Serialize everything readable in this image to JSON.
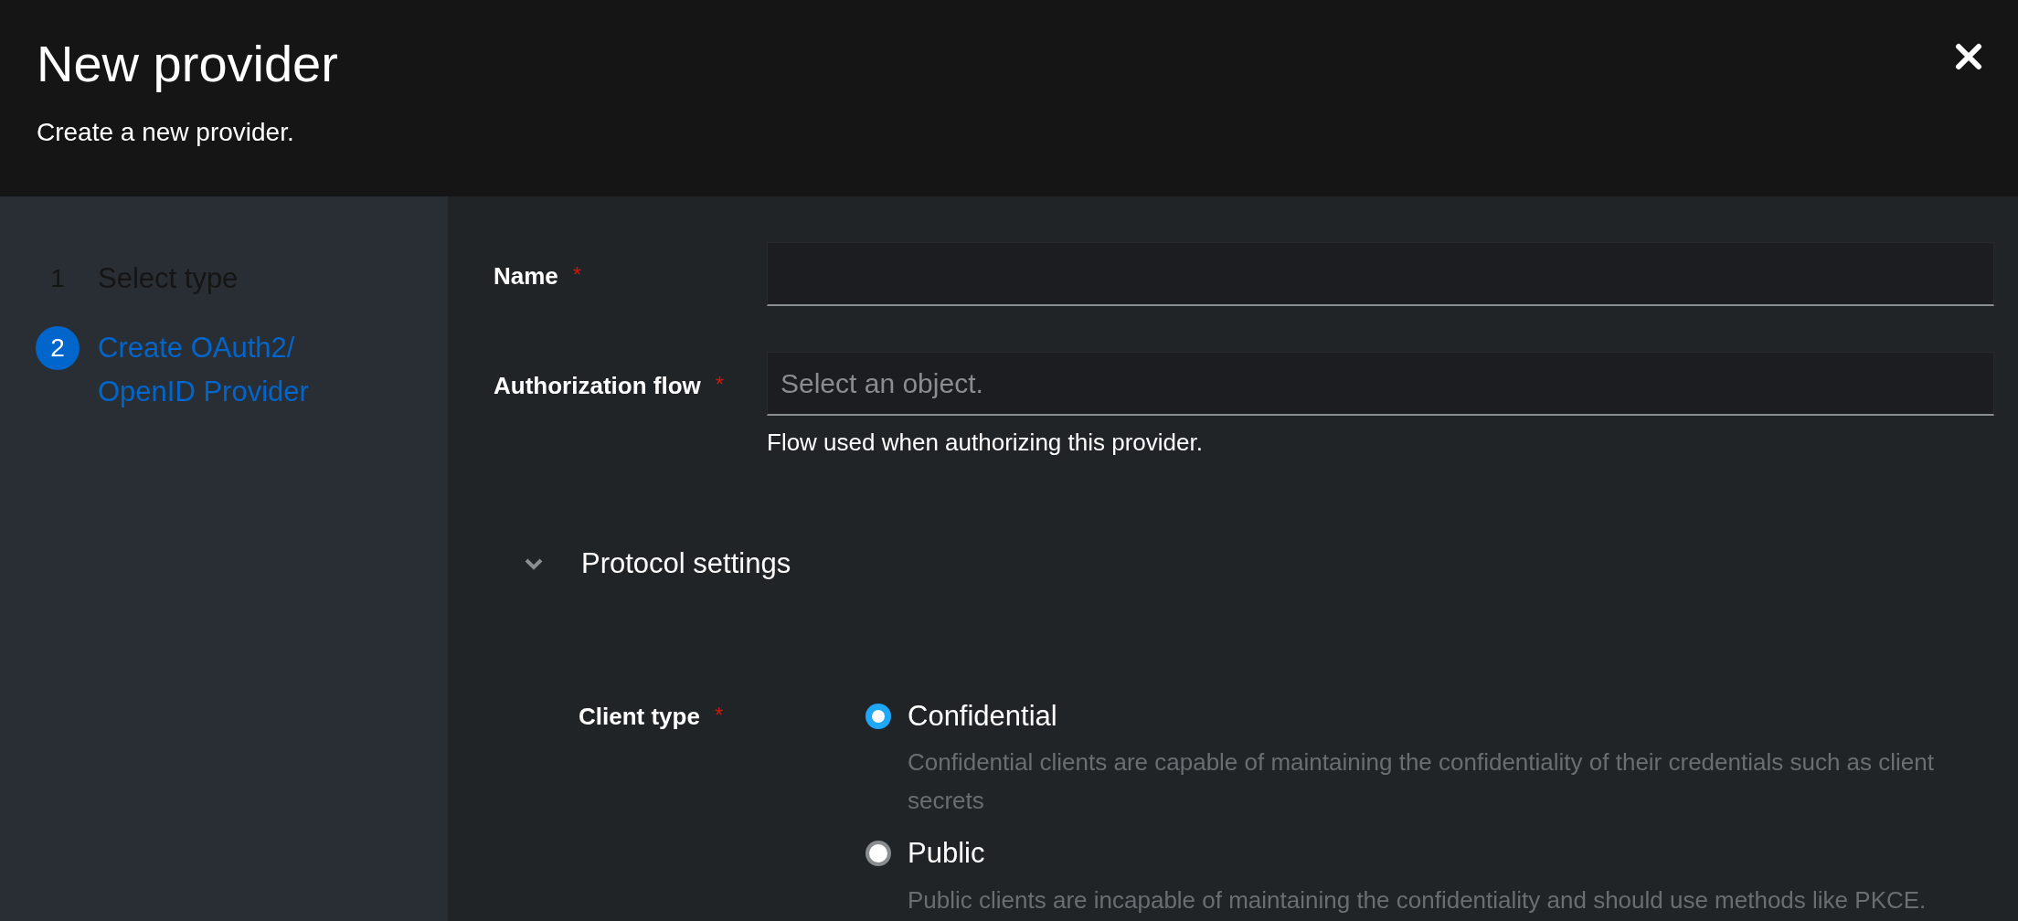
{
  "header": {
    "title": "New provider",
    "subtitle": "Create a new provider."
  },
  "steps": [
    {
      "number": "1",
      "label": "Select type",
      "selected": false
    },
    {
      "number": "2",
      "label": "Create OAuth2/ OpenID Provider",
      "selected": true
    }
  ],
  "fields": [
    {
      "label": "Name",
      "required_mark": "*"
    },
    {
      "label": "Authorization flow",
      "required_mark": "*",
      "placeholder": "Select an object.",
      "helper": "Flow used when authorizing this provider."
    }
  ],
  "section": {
    "title": "Protocol settings",
    "expanded": true
  },
  "client_type": {
    "label": "Client type",
    "required_mark": "*",
    "options": [
      {
        "label": "Confidential",
        "description": "Confidential clients are capable of maintaining the confidentiality of their credentials such as client secrets",
        "selected": true
      },
      {
        "label": "Public",
        "description": "Public clients are incapable of maintaining the confidentiality and should use methods like PKCE.",
        "selected": false
      }
    ]
  }
}
